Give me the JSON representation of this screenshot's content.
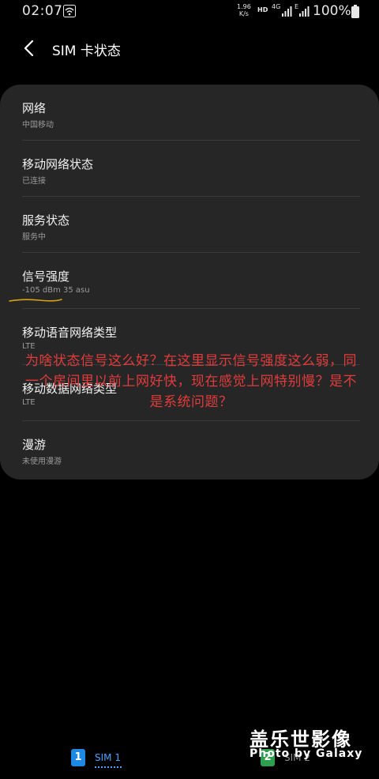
{
  "status_bar": {
    "time": "02:07",
    "speed_value": "1.96",
    "speed_unit": "K/s",
    "hd": "HD",
    "net_type_1": "4G",
    "net_type_2": "E",
    "battery": "100%"
  },
  "header": {
    "title": "SIM 卡状态"
  },
  "rows": [
    {
      "title": "网络",
      "value": "中国移动"
    },
    {
      "title": "移动网络状态",
      "value": "已连接"
    },
    {
      "title": "服务状态",
      "value": "服务中"
    },
    {
      "title": "信号强度",
      "value": "-105 dBm 35 asu"
    },
    {
      "title": "移动语音网络类型",
      "value": "LTE"
    },
    {
      "title": "移动数据网络类型",
      "value": "LTE"
    },
    {
      "title": "漫游",
      "value": "未使用漫游"
    }
  ],
  "annotation": {
    "comment": "为啥状态信号这么好？在这里显示信号强度这么弱，同一个房间里以前上网好快，现在感觉上网特别慢？是不是系统问题？",
    "color": "#e23b3b"
  },
  "sim_tabs": [
    {
      "badge": "1",
      "label": "SIM 1",
      "color": "#1e88e5"
    },
    {
      "badge": "2",
      "label": "SIM 2",
      "color": "#2e9e4f"
    }
  ],
  "watermark": {
    "title": "盖乐世影像",
    "subtitle": "Photo by Galaxy"
  }
}
